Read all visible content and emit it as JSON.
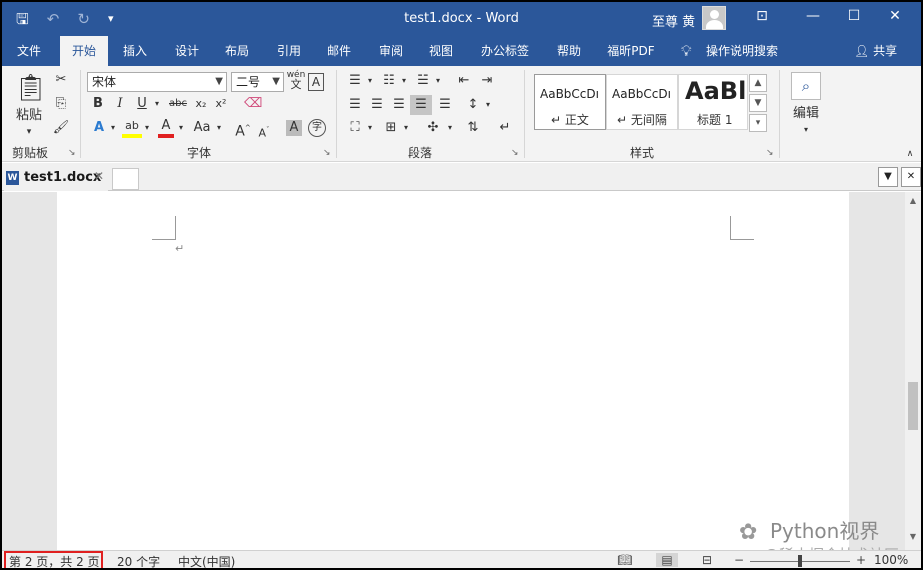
{
  "window": {
    "title": "test1.docx  -  Word",
    "user_name": "至尊 黄"
  },
  "quick_access": {
    "save_icon": "save-icon",
    "undo_icon": "undo-icon",
    "redo_icon": "redo-icon",
    "customize_icon": "customize-icon"
  },
  "ribbon_tabs": [
    "文件",
    "开始",
    "插入",
    "设计",
    "布局",
    "引用",
    "邮件",
    "审阅",
    "视图",
    "办公标签",
    "帮助",
    "福昕PDF"
  ],
  "active_tab": "开始",
  "tell_me": "操作说明搜索",
  "share": "共享",
  "clipboard": {
    "paste_label": "粘贴",
    "group_label": "剪贴板"
  },
  "font": {
    "font_name": "宋体",
    "font_size": "二号",
    "group_label": "字体",
    "phonetic_text": "wén",
    "phonetic_char": "文",
    "bold": "B",
    "italic": "I",
    "underline": "U",
    "strike": "abc",
    "subscript": "x₂",
    "superscript": "x²",
    "grow": "A",
    "shrink": "A",
    "case": "Aa",
    "char_shading": "A",
    "enclose": "字",
    "highlight_color": "#ffff00",
    "font_color": "#e02020"
  },
  "paragraph": {
    "group_label": "段落"
  },
  "styles": {
    "group_label": "样式",
    "items": [
      {
        "sample": "AaBbCcDı",
        "name": "正文"
      },
      {
        "sample": "AaBbCcDı",
        "name": "无间隔"
      },
      {
        "sample": "AaBl",
        "name": "标题 1"
      }
    ]
  },
  "editing": {
    "label": "编辑"
  },
  "doc_tab": {
    "name": "test1.docx",
    "word_badge": "W"
  },
  "status": {
    "page_info": "第 2 页，共 2 页",
    "word_count": "20 个字",
    "language": "中文(中国)",
    "zoom": "100%"
  },
  "watermark": {
    "main": "Python视界",
    "sub": "@稀土掘金技术社区"
  },
  "colors": {
    "title_bar": "#2b579a",
    "ribbon_bg": "#f3f3f3",
    "highlight_box": "#e02020"
  }
}
